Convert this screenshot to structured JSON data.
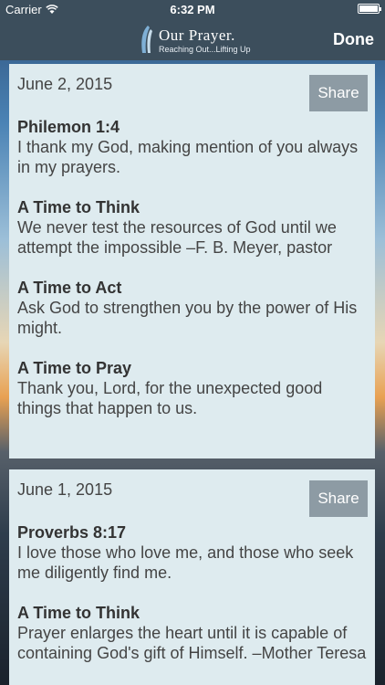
{
  "status": {
    "carrier": "Carrier",
    "time": "6:32 PM"
  },
  "nav": {
    "logo_name": "Our Prayer.",
    "logo_tagline": "Reaching Out...Lifting Up",
    "done_label": "Done"
  },
  "share_label": "Share",
  "devotions": [
    {
      "date": "June 2, 2015",
      "sections": [
        {
          "heading": "Philemon 1:4",
          "text": "I thank my God, making mention of you always in my prayers."
        },
        {
          "heading": "A Time to Think",
          "text": "We never test the resources of God until we attempt the impossible –F. B. Meyer, pastor"
        },
        {
          "heading": "A Time to Act",
          "text": "Ask God to strengthen you by the power of His might."
        },
        {
          "heading": "A Time to Pray",
          "text": "Thank you, Lord, for the unexpected good things that happen to us."
        }
      ]
    },
    {
      "date": "June 1, 2015",
      "sections": [
        {
          "heading": "Proverbs 8:17",
          "text": "I love those who love me, and those who seek me diligently find me."
        },
        {
          "heading": "A Time to Think",
          "text": "Prayer enlarges the heart until it is capable of containing God's gift of Himself. –Mother Teresa"
        }
      ]
    }
  ]
}
